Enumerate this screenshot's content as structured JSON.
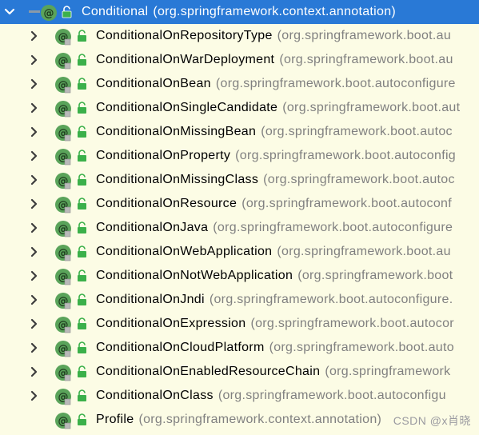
{
  "colors": {
    "background": "#fcfce5",
    "selection": "#2979d6",
    "package_text": "#808080",
    "annotation_icon": "#5aa35a",
    "lock_icon": "#3bb04a"
  },
  "root": {
    "name": "Conditional",
    "package": "(org.springframework.context.annotation)",
    "expanded": true
  },
  "children": [
    {
      "name": "ConditionalOnRepositoryType",
      "package": "(org.springframework.boot.au",
      "expandable": true
    },
    {
      "name": "ConditionalOnWarDeployment",
      "package": "(org.springframework.boot.au",
      "expandable": true
    },
    {
      "name": "ConditionalOnBean",
      "package": "(org.springframework.boot.autoconfigure",
      "expandable": true
    },
    {
      "name": "ConditionalOnSingleCandidate",
      "package": "(org.springframework.boot.aut",
      "expandable": true
    },
    {
      "name": "ConditionalOnMissingBean",
      "package": "(org.springframework.boot.autoc",
      "expandable": true
    },
    {
      "name": "ConditionalOnProperty",
      "package": "(org.springframework.boot.autoconfig",
      "expandable": true
    },
    {
      "name": "ConditionalOnMissingClass",
      "package": "(org.springframework.boot.autoc",
      "expandable": true
    },
    {
      "name": "ConditionalOnResource",
      "package": "(org.springframework.boot.autoconf",
      "expandable": true
    },
    {
      "name": "ConditionalOnJava",
      "package": "(org.springframework.boot.autoconfigure",
      "expandable": true
    },
    {
      "name": "ConditionalOnWebApplication",
      "package": "(org.springframework.boot.au",
      "expandable": true
    },
    {
      "name": "ConditionalOnNotWebApplication",
      "package": "(org.springframework.boot",
      "expandable": true
    },
    {
      "name": "ConditionalOnJndi",
      "package": "(org.springframework.boot.autoconfigure.",
      "expandable": true
    },
    {
      "name": "ConditionalOnExpression",
      "package": "(org.springframework.boot.autocor",
      "expandable": true
    },
    {
      "name": "ConditionalOnCloudPlatform",
      "package": "(org.springframework.boot.auto",
      "expandable": true
    },
    {
      "name": "ConditionalOnEnabledResourceChain",
      "package": "(org.springframework",
      "expandable": true
    },
    {
      "name": "ConditionalOnClass",
      "package": "(org.springframework.boot.autoconfigu",
      "expandable": true
    },
    {
      "name": "Profile",
      "package": "(org.springframework.context.annotation)",
      "expandable": false
    }
  ],
  "watermark": "CSDN @x肖晓"
}
